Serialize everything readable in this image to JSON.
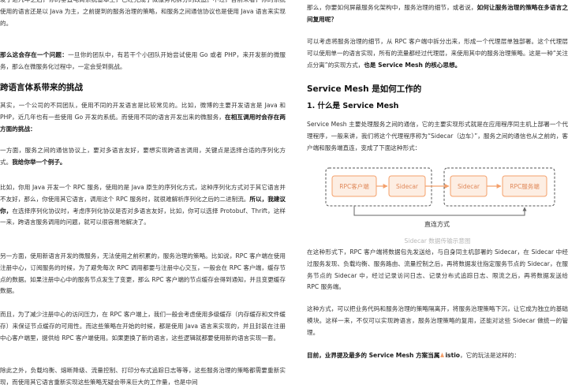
{
  "left": {
    "p1": "发了这几年之后，你的垂直电商系统基本上，已经完成了微服务化拆分的改造。不过，目前来看，你的系统使用的语言还是以 Java 为主，之前提到的服务治理的策略，和服务之间通信协议也是使用 Java 语言来实现的。",
    "p2_bold": "那么这会存在一个问题：",
    "p2_rest": "一旦你的团队中，有若干个小团队开始尝试使用 Go 或者 PHP，来开发新的微服务，那么在微服务化过程中，一定会受到挑战。",
    "h_challenge": "跨语言体系带来的挑战",
    "p3_a": "其实，一个公司的不同团队，使用不同的开发语言是比较常见的。比如，微博的主要开发语言是 Java 和 PHP，近几年也有一些使用 Go 开发的系统。而使用不同的语言开发出来的微服务，",
    "p3_bold": "在相互调用时会存在两方面的挑战：",
    "p4_a": "一方面，服务之间的通信协议上，要对多语言友好，要想实现跨语言调用，关键点是选择合适的序列化方式。",
    "p4_bold": "我给你举一个例子。",
    "p5_a": "比如，你用 Java 开发一个 RPC 服务，使用的是 Java 原生的序列化方式，这种序列化方式对于其它语言并不友好，那么，你使用其它语言，调用这个 RPC 服务时，就很难解析序列化之后的二进制流。",
    "p5_bold": "所以，我建议你，",
    "p5_b": "在选择序列化协议时，考虑序列化协议是否对多语言友好，比如，你可以选择 Protobuf、Thrift，这样一来，跨语言服务调用的问题，就可以很容易地解决了。",
    "p6": "另一方面，使用新语言开发的微服务，无法使用之前积累的，服务治理的策略。比如说，RPC 客户端在使用注册中心，订阅服务的时候，为了避免每次 RPC 调用都要与注册中心交互，一般会在 RPC 客户端，缓存节点的数据。如果注册中心中的服务节点发生了变更，那么 RPC 客户端的节点缓存会得到通知，并且变更缓存数据。",
    "p7": "而且，为了减少注册中心的访问压力，在 RPC 客户端上，我们一般会考虑使用多级缓存（内存缓存和文件缓存）来保证节点缓存的可用性。而这些策略在开始的时候，都是使用 Java 语言来实现的，并且封装在注册中心客户端里，提供给 RPC 客户端使用。如果更换了新的语言，这些逻辑就都要使用新的语言实现一套。",
    "p8": "除此之外，负载均衡、熔断降级、流量控制、打印分布式追踪日志等等，这些服务治理的策略都需要重新实现，而使用其它语言重新实现这些策略无疑会带来巨大的工作量，也是中间"
  },
  "right": {
    "p1_a": "那么，你要如何屏蔽服务化架构中，服务治理的细节，或者说，",
    "p1_bold": "如何让服务治理的策略在多语言之间复用呢？",
    "p2_a": "可以考虑将服务治理的细节，从 RPC 客户端中拆分出来，形成一个代理层单独部署。这个代理层可以使用单一的语言实现，所有的流量都经过代理层，来使用其中的服务治理策略。这是一种“关注点分离”的实现方式，",
    "p2_bold": "也是 Service Mesh 的核心思想。",
    "h_mesh": "Service Mesh 是如何工作的",
    "h_what": "1. 什么是 Service Mesh",
    "p3": "Service Mesh 主要处理服务之间的通信，它的主要实现形式就是在应用程序同主机上部署一个代理程序，一般来讲，我们将这个代理程序称为“Sidecar（边车）”，服务之间的通信也从之前的，客户端和服务端直连，变成了下面这种形式：",
    "figure": {
      "rpc_client": "RPC客户端",
      "sidecar_a": "Sidecar",
      "sidecar_b": "Sidecar",
      "rpc_server": "RPC服务端",
      "direct_label": "直连方式",
      "caption": "Sidecar 数据传输示意图"
    },
    "p4": "在这种形式下，RPC 客户端将数据包先发送给，与自身同主机部署的 Sidecar，在 Sidecar 中经过服务发现、负载均衡、服务路由、流量控制之后，再将数据发往指定服务节点的 Sidecar，在服务节点的 Sidecar 中，经过记录访问日志、记录分布式追踪日志、限流之后，再将数据发送给 RPC 服务端。",
    "p5": "这种方式，可以把业务代码和服务治理的策略隔离开，将服务治理策略下沉，让它成为独立的基础模块。这样一来，不仅可以实现跨语言，服务治理策略的复用，还能对这些 Sidecar 做统一的管理。",
    "p6_bold_a": "目前，业界提及最多的 Service Mesh 方案当属",
    "p6_bold_b": "istio",
    "p6_rest": "，它的玩法是这样的："
  },
  "colors": {
    "diagram_orange": "#f4a06b",
    "diagram_box_fill": "#fdeee3",
    "dashed_border": "#555555",
    "caption_gray": "#b8b8b8"
  },
  "icons": [
    "istio-icon"
  ]
}
